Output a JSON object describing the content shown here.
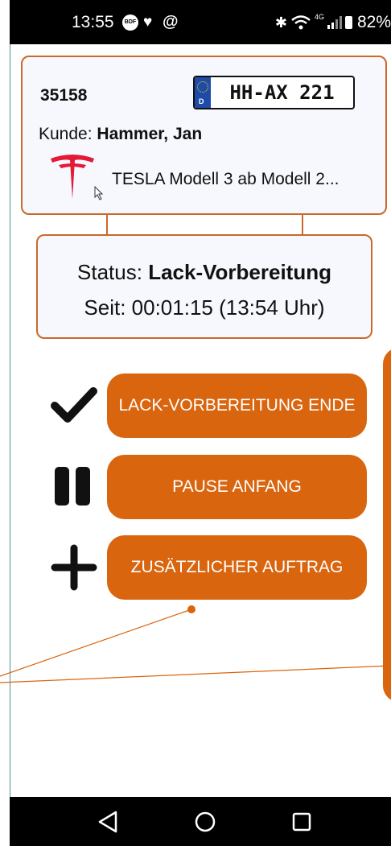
{
  "status_bar": {
    "time": "13:55",
    "icons": [
      "bdf-app-icon",
      "m-app-icon",
      "threads-icon"
    ],
    "right_icons": [
      "bluetooth-icon",
      "wifi-icon",
      "4g-icon",
      "signal-icon",
      "battery-icon"
    ],
    "network": "4G",
    "battery": "82%"
  },
  "vehicle": {
    "order_number": "35158",
    "plate_country": "D",
    "plate": "HH-AX 221",
    "customer_label": "Kunde:",
    "customer_name": "Hammer, Jan",
    "brand_icon": "tesla-logo",
    "model": "TESLA Modell 3 ab Modell 2..."
  },
  "status": {
    "status_label": "Status:",
    "status_value": "Lack-Vorbereitung",
    "since_label": "Seit:",
    "since_value": "00:01:15 (13:54 Uhr)"
  },
  "actions": [
    {
      "icon": "checkmark-icon",
      "label": "LACK-VORBEREITUNG ENDE"
    },
    {
      "icon": "pause-icon",
      "label": "PAUSE ANFANG"
    },
    {
      "icon": "plus-icon",
      "label": "ZUSÄTZLICHER AUFTRAG"
    }
  ],
  "colors": {
    "accent": "#d9650f",
    "card_border": "#c9692a",
    "card_bg": "#f7f8fd",
    "bar": "#000000"
  },
  "nav": [
    "back-icon",
    "home-icon",
    "recents-icon"
  ]
}
